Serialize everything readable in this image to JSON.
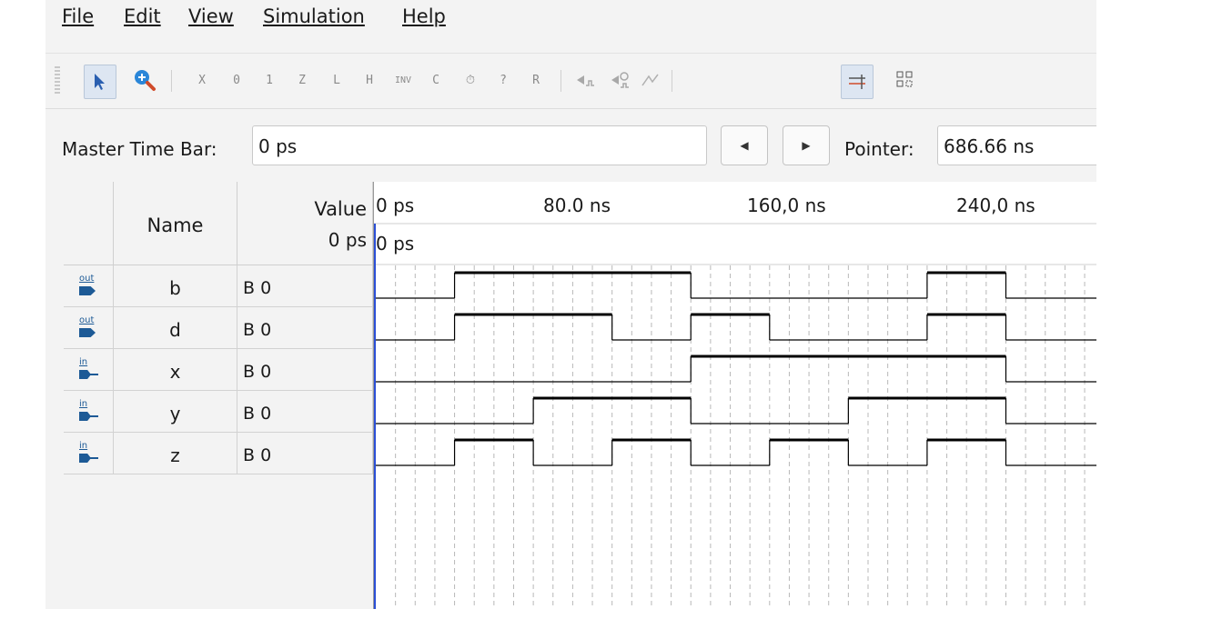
{
  "menu": [
    {
      "label": "File"
    },
    {
      "label": "Edit"
    },
    {
      "label": "View"
    },
    {
      "label": "Simulation"
    },
    {
      "label": "Help"
    }
  ],
  "toolbar": {
    "items": [
      {
        "icon": "selection-pointer-icon",
        "active": true
      },
      {
        "icon": "zoom-icon"
      },
      {
        "icon": "force-unknown-icon",
        "glyph": "X"
      },
      {
        "icon": "force-low-icon",
        "glyph": "0"
      },
      {
        "icon": "force-high-icon",
        "glyph": "1"
      },
      {
        "icon": "force-high-impedance-icon",
        "glyph": "Z"
      },
      {
        "icon": "weak-low-icon",
        "glyph": "L"
      },
      {
        "icon": "weak-high-icon",
        "glyph": "H"
      },
      {
        "icon": "invert-icon",
        "glyph": "INV"
      },
      {
        "icon": "count-value-icon",
        "glyph": "C"
      },
      {
        "icon": "clock-icon",
        "glyph": "⏱"
      },
      {
        "icon": "arbitrary-value-icon",
        "glyph": "?"
      },
      {
        "icon": "random-values-icon",
        "glyph": "R"
      },
      {
        "icon": "run-functional-simulation-icon"
      },
      {
        "icon": "run-timing-simulation-icon"
      },
      {
        "icon": "generate-netlist-icon"
      },
      {
        "icon": "snap-to-grid-icon",
        "active": true
      },
      {
        "icon": "grid-settings-icon"
      }
    ]
  },
  "timebar": {
    "master_label": "Master Time Bar:",
    "master_value": "0 ps",
    "pointer_label": "Pointer:",
    "pointer_value": "686.66 ns"
  },
  "table": {
    "headers": {
      "name": "Name",
      "value": "Value",
      "value_time": "0 ps"
    },
    "rows": [
      {
        "pin_type": "out",
        "name": "b",
        "value": "B 0"
      },
      {
        "pin_type": "out",
        "name": "d",
        "value": "B 0"
      },
      {
        "pin_type": "in",
        "name": "x",
        "value": "B 0"
      },
      {
        "pin_type": "in",
        "name": "y",
        "value": "B 0"
      },
      {
        "pin_type": "in",
        "name": "z",
        "value": "B 0"
      }
    ]
  },
  "waveform": {
    "time_labels": [
      "0 ps",
      "80.0 ns",
      "160,0 ns",
      "240,0 ns"
    ],
    "cursor_time": "0 ps",
    "time_unit": "ns",
    "grid_step_ns": 10,
    "signals": {
      "b": [
        [
          0,
          0
        ],
        [
          40,
          1
        ],
        [
          160,
          0
        ],
        [
          280,
          1
        ],
        [
          320,
          0
        ]
      ],
      "d": [
        [
          0,
          0
        ],
        [
          40,
          1
        ],
        [
          120,
          0
        ],
        [
          160,
          1
        ],
        [
          200,
          0
        ],
        [
          280,
          1
        ],
        [
          320,
          0
        ]
      ],
      "x": [
        [
          0,
          0
        ],
        [
          160,
          1
        ],
        [
          320,
          0
        ]
      ],
      "y": [
        [
          0,
          0
        ],
        [
          80,
          1
        ],
        [
          160,
          0
        ],
        [
          240,
          1
        ],
        [
          320,
          0
        ]
      ],
      "z": [
        [
          0,
          0
        ],
        [
          40,
          1
        ],
        [
          80,
          0
        ],
        [
          120,
          1
        ],
        [
          160,
          0
        ],
        [
          200,
          1
        ],
        [
          240,
          0
        ],
        [
          280,
          1
        ],
        [
          320,
          0
        ]
      ]
    }
  },
  "colors": {
    "pin": "#1d5a96",
    "cursor": "#2a4fd6",
    "waveform": "#000000",
    "grid": "#b8b8b8"
  }
}
